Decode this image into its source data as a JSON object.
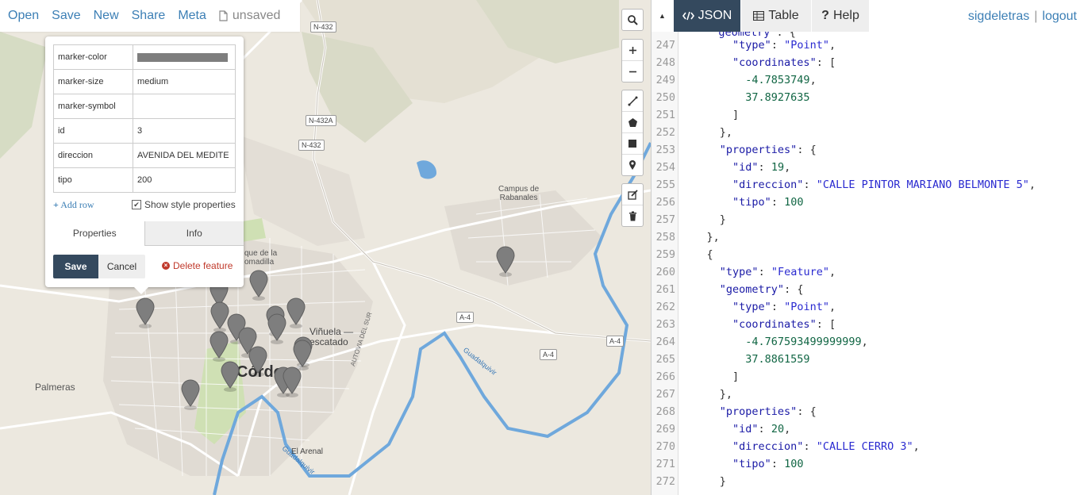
{
  "menu": {
    "open": "Open",
    "save": "Save",
    "new": "New",
    "share": "Share",
    "meta": "Meta",
    "unsaved": "unsaved"
  },
  "map": {
    "labels": {
      "n432_top": "N-432",
      "n432a": "N-432A",
      "n432_mid": "N-432",
      "campus_line1": "Campus de",
      "campus_line2": "Rabanales",
      "parque_line1": "que de la",
      "parque_line2": "omadilla",
      "vinuela_line1": "Viñuela —",
      "vinuela_line2": "escatado",
      "a4_a": "A-4",
      "a4_b": "A-4",
      "a4_c": "A-4",
      "cordoba": "Córdo",
      "palmeras": "Palmeras",
      "autovia": "AUTOVIA DEL SUR",
      "guadalquivir_a": "Guadalquivir",
      "guadalquivir_b": "Guadalquivir",
      "elarenal": "El Arenal"
    },
    "marker_color": "#7e7e7e"
  },
  "popup": {
    "rows": [
      {
        "key": "marker-color",
        "value": ""
      },
      {
        "key": "marker-size",
        "value": "medium"
      },
      {
        "key": "marker-symbol",
        "value": ""
      },
      {
        "key": "id",
        "value": "3"
      },
      {
        "key": "direccion",
        "value": "AVENIDA DEL MEDITE"
      },
      {
        "key": "tipo",
        "value": "200"
      }
    ],
    "add_row": "Add row",
    "show_style": "Show style properties",
    "tab_properties": "Properties",
    "tab_info": "Info",
    "save": "Save",
    "cancel": "Cancel",
    "delete": "Delete feature"
  },
  "pane": {
    "tab_json": "JSON",
    "tab_table": "Table",
    "tab_help": "Help",
    "user": "sigdeletras",
    "separator": "|",
    "logout": "logout"
  },
  "code": {
    "top_partial": "  \"geometry\": {",
    "lines": [
      {
        "n": "247",
        "text": "        \"type\": \"Point\","
      },
      {
        "n": "248",
        "text": "        \"coordinates\": ["
      },
      {
        "n": "249",
        "text": "          -4.7853749,"
      },
      {
        "n": "250",
        "text": "          37.8927635"
      },
      {
        "n": "251",
        "text": "        ]"
      },
      {
        "n": "252",
        "text": "      },"
      },
      {
        "n": "253",
        "text": "      \"properties\": {"
      },
      {
        "n": "254",
        "text": "        \"id\": 19,"
      },
      {
        "n": "255",
        "text": "        \"direccion\": \"CALLE PINTOR MARIANO BELMONTE 5\","
      },
      {
        "n": "256",
        "text": "        \"tipo\": 100"
      },
      {
        "n": "257",
        "text": "      }"
      },
      {
        "n": "258",
        "text": "    },"
      },
      {
        "n": "259",
        "text": "    {"
      },
      {
        "n": "260",
        "text": "      \"type\": \"Feature\","
      },
      {
        "n": "261",
        "text": "      \"geometry\": {"
      },
      {
        "n": "262",
        "text": "        \"type\": \"Point\","
      },
      {
        "n": "263",
        "text": "        \"coordinates\": ["
      },
      {
        "n": "264",
        "text": "          -4.767593499999999,"
      },
      {
        "n": "265",
        "text": "          37.8861559"
      },
      {
        "n": "266",
        "text": "        ]"
      },
      {
        "n": "267",
        "text": "      },"
      },
      {
        "n": "268",
        "text": "      \"properties\": {"
      },
      {
        "n": "269",
        "text": "        \"id\": 20,"
      },
      {
        "n": "270",
        "text": "        \"direccion\": \"CALLE CERRO 3\","
      },
      {
        "n": "271",
        "text": "        \"tipo\": 100"
      },
      {
        "n": "272",
        "text": "      }"
      }
    ]
  }
}
